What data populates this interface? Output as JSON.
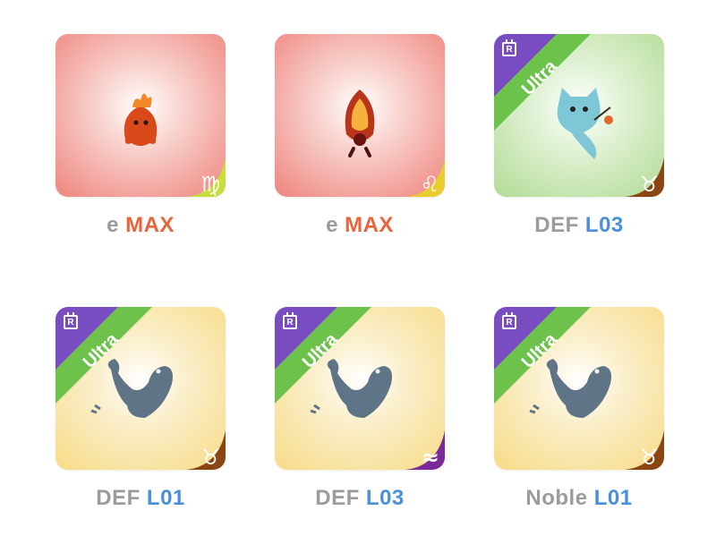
{
  "cards": [
    {
      "id": "c1",
      "bg": "red",
      "ultra": false,
      "zodiac": "♍",
      "zodiac_name": "virgo",
      "zodiac_color": "#c7dd3b",
      "cap_a": "e",
      "cap_b": "MAX",
      "cap_b_color": "orange"
    },
    {
      "id": "c2",
      "bg": "red",
      "ultra": false,
      "zodiac": "♌",
      "zodiac_name": "leo",
      "zodiac_color": "#e9cc30",
      "cap_a": "e",
      "cap_b": "MAX",
      "cap_b_color": "orange"
    },
    {
      "id": "c3",
      "bg": "green",
      "ultra": true,
      "zodiac": "♉",
      "zodiac_name": "taurus",
      "zodiac_color": "#8b4513",
      "cap_a": "DEF",
      "cap_b": "L03",
      "cap_b_color": "blue"
    },
    {
      "id": "c4",
      "bg": "yellow",
      "ultra": true,
      "zodiac": "♉",
      "zodiac_name": "taurus",
      "zodiac_color": "#8b4513",
      "cap_a": "DEF",
      "cap_b": "L01",
      "cap_b_color": "blue"
    },
    {
      "id": "c5",
      "bg": "yellow",
      "ultra": true,
      "zodiac": "≈",
      "zodiac_name": "aquarius",
      "zodiac_color": "#7b2a9a",
      "cap_a": "DEF",
      "cap_b": "L03",
      "cap_b_color": "blue"
    },
    {
      "id": "c6",
      "bg": "yellow",
      "ultra": true,
      "zodiac": "♉",
      "zodiac_name": "taurus",
      "zodiac_color": "#8b4513",
      "cap_a": "Noble",
      "cap_b": "L01",
      "cap_b_color": "blue"
    }
  ],
  "ultra_label": "Ultra",
  "r_badge_label": "R",
  "colors": {
    "red_bg": "#f08a84",
    "green_bg": "#b5dd9a",
    "yellow_bg": "#f7dd8c",
    "ultra_green": "#6cc24a",
    "r_purple": "#7a4cc2"
  }
}
